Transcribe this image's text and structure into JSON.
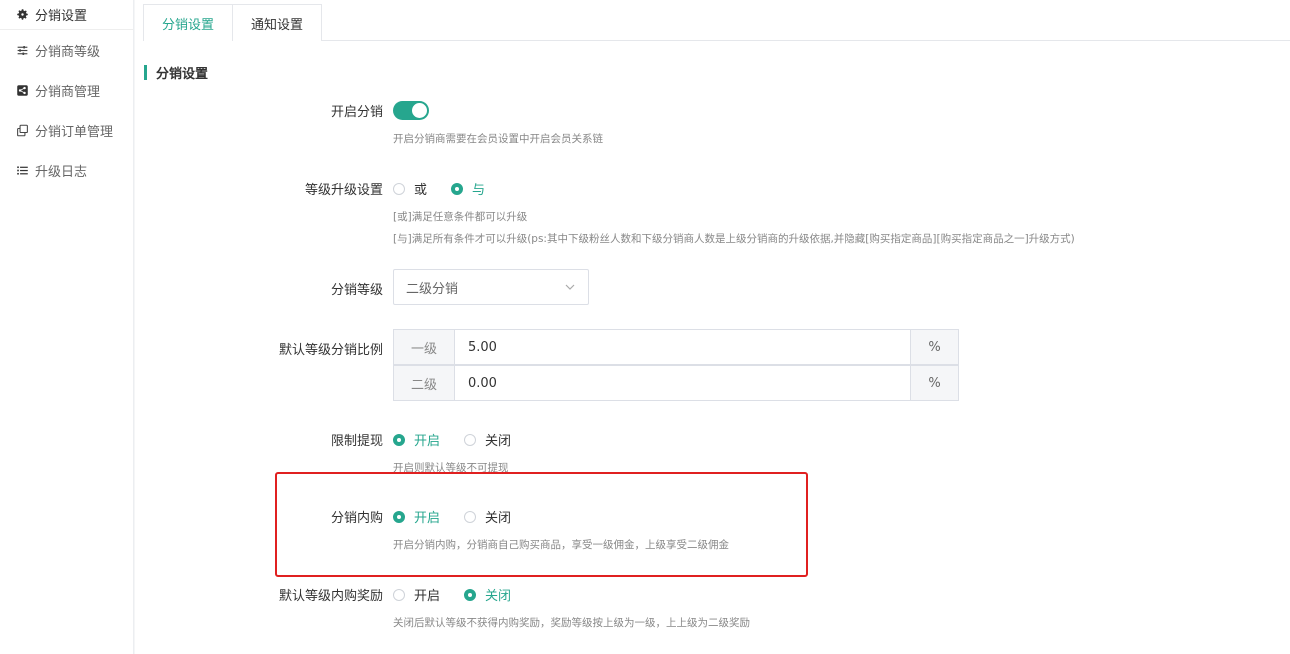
{
  "sidebar": {
    "items": [
      {
        "label": "分销设置",
        "icon": "gear-icon"
      },
      {
        "label": "分销商等级",
        "icon": "sliders-icon"
      },
      {
        "label": "分销商管理",
        "icon": "share-icon"
      },
      {
        "label": "分销订单管理",
        "icon": "copy-icon"
      },
      {
        "label": "升级日志",
        "icon": "list-icon"
      }
    ]
  },
  "tabs": [
    {
      "label": "分销设置"
    },
    {
      "label": "通知设置"
    }
  ],
  "section_title": "分销设置",
  "form": {
    "enable": {
      "label": "开启分销",
      "help": "开启分销商需要在会员设置中开启会员关系链"
    },
    "upgrade": {
      "label": "等级升级设置",
      "options": [
        "或",
        "与"
      ],
      "selected": "与",
      "help1": "[或]满足任意条件都可以升级",
      "help2": "[与]满足所有条件才可以升级(ps:其中下级粉丝人数和下级分销商人数是上级分销商的升级依据,并隐藏[购买指定商品][购买指定商品之一]升级方式)"
    },
    "level": {
      "label": "分销等级",
      "value": "二级分销"
    },
    "ratio": {
      "label": "默认等级分销比例",
      "rows": [
        {
          "prefix": "一级",
          "value": "5.00",
          "suffix": "%"
        },
        {
          "prefix": "二级",
          "value": "0.00",
          "suffix": "%"
        }
      ]
    },
    "withdraw": {
      "label": "限制提现",
      "options": [
        "开启",
        "关闭"
      ],
      "selected": "开启",
      "help": "开启则默认等级不可提现"
    },
    "internal": {
      "label": "分销内购",
      "options": [
        "开启",
        "关闭"
      ],
      "selected": "开启",
      "help": "开启分销内购，分销商自己购买商品，享受一级佣金，上级享受二级佣金"
    },
    "internal_reward": {
      "label": "默认等级内购奖励",
      "options": [
        "开启",
        "关闭"
      ],
      "selected": "关闭",
      "help": "关闭后默认等级不获得内购奖励，奖励等级按上级为一级，上上级为二级奖励"
    }
  },
  "colors": {
    "accent": "#26a68e",
    "highlight": "#e02020"
  }
}
